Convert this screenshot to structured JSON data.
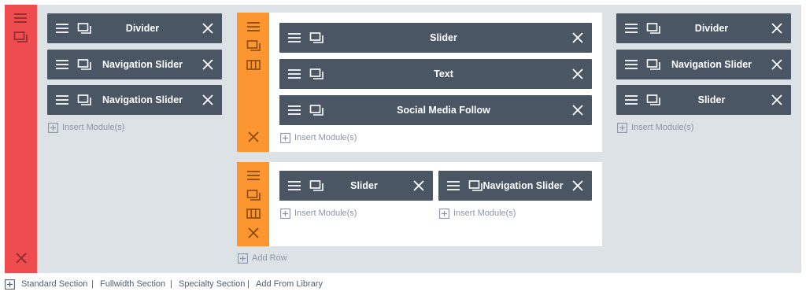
{
  "colors": {
    "section_bar": "#ef4c4f",
    "row_bar": "#fb9631",
    "module_bg": "#4b5665",
    "canvas_bg": "#dde2e6"
  },
  "section": {
    "icons": [
      "menu-icon",
      "duplicate-icon",
      "close-icon"
    ],
    "left_column": {
      "modules": [
        {
          "label": "Divider"
        },
        {
          "label": "Navigation Slider"
        },
        {
          "label": "Navigation Slider"
        }
      ],
      "insert_label": "Insert Module(s)"
    },
    "row1": {
      "icons": [
        "menu-icon",
        "duplicate-icon",
        "columns-icon",
        "close-icon"
      ],
      "modules": [
        {
          "label": "Slider"
        },
        {
          "label": "Text"
        },
        {
          "label": "Social Media Follow"
        }
      ],
      "insert_label": "Insert Module(s)"
    },
    "row2": {
      "icons": [
        "menu-icon",
        "duplicate-icon",
        "columns-icon",
        "close-icon"
      ],
      "col1": {
        "modules": [
          {
            "label": "Slider"
          }
        ],
        "insert_label": "Insert Module(s)"
      },
      "col2": {
        "modules": [
          {
            "label": "Navigation Slider"
          }
        ],
        "insert_label": "Insert Module(s)"
      }
    },
    "add_row_label": "Add Row",
    "right_column": {
      "modules": [
        {
          "label": "Divider"
        },
        {
          "label": "Navigation Slider"
        },
        {
          "label": "Slider"
        }
      ],
      "insert_label": "Insert Module(s)"
    }
  },
  "footer": {
    "links": [
      "Standard Section",
      "Fullwidth Section",
      "Specialty Section",
      "Add From Library"
    ],
    "separator": "|"
  }
}
